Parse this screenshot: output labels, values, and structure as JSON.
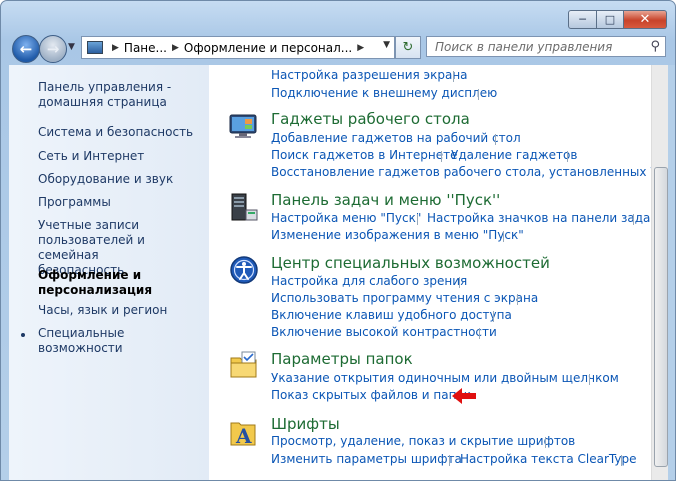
{
  "search": {
    "placeholder": "Поиск в панели управления"
  },
  "address": {
    "crumb1": "Пане...",
    "crumb2": "Оформление и персонал..."
  },
  "sidebar": {
    "items": [
      {
        "label": "Панель управления -\nдомашняя страница"
      },
      {
        "label": "Система и безопасность"
      },
      {
        "label": "Сеть и Интернет"
      },
      {
        "label": "Оборудование и звук"
      },
      {
        "label": "Программы"
      },
      {
        "label": "Учетные записи\nпользователей и семейная\nбезопасность"
      },
      {
        "label": "Оформление и\nперсонализация"
      },
      {
        "label": "Часы, язык и регион"
      },
      {
        "label": "Специальные возможности"
      }
    ]
  },
  "sections": {
    "display": {
      "links": [
        "Настройка разрешения экрана",
        "Подключение к внешнему дисплею"
      ]
    },
    "gadgets": {
      "title": "Гаджеты рабочего стола",
      "links": [
        "Добавление гаджетов на рабочий стол",
        "Поиск гаджетов в Интернете",
        "Удаление гаджетов",
        "Восстановление гаджетов рабочего стола, установленных Window"
      ]
    },
    "taskbar": {
      "title": "Панель задач и меню ''Пуск''",
      "links": [
        "Настройка меню \"Пуск\"",
        "Настройка значков на панели задач",
        "Изменение изображения в меню \"Пуск\""
      ]
    },
    "ease": {
      "title": "Центр специальных возможностей",
      "links": [
        "Настройка для слабого зрения",
        "Использовать программу чтения с экрана",
        "Включение клавиш удобного доступа",
        "Включение высокой контрастности"
      ]
    },
    "folders": {
      "title": "Параметры папок",
      "links": [
        "Указание открытия одиночным или двойным щелчком",
        "Показ скрытых файлов и папок"
      ]
    },
    "fonts": {
      "title": "Шрифты",
      "links": [
        "Просмотр, удаление, показ и скрытие шрифтов",
        "Изменить параметры шрифта",
        "Настройка текста ClearType"
      ]
    }
  },
  "colors": {
    "link": "#0b56b5",
    "heading": "#1d6b33",
    "arrow": "#e01010"
  }
}
